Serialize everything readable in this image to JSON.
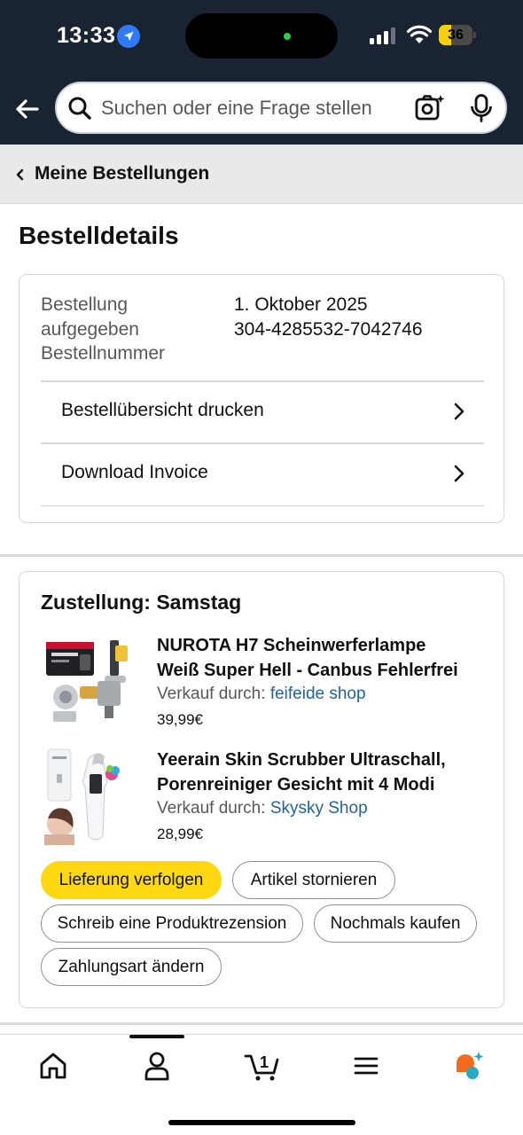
{
  "status_bar": {
    "time": "13:33",
    "battery": "36",
    "battery_level": 0.36
  },
  "header": {
    "search_placeholder": "Suchen oder eine Frage stellen"
  },
  "breadcrumb": {
    "label": "Meine Bestellungen"
  },
  "page": {
    "title": "Bestelldetails"
  },
  "order": {
    "label": "Bestellung aufgegeben Bestellnummer",
    "date": "1. Oktober 2025",
    "number": "304-4285532-7042746",
    "rows": [
      {
        "label": "Bestellübersicht drucken"
      },
      {
        "label": "Download Invoice"
      }
    ]
  },
  "delivery": {
    "title": "Zustellung: Samstag",
    "seller_prefix": "Verkauf durch:",
    "items": [
      {
        "title_line1": "NUROTA H7 Scheinwerferlampe",
        "title_line2": "Weiß Super Hell - Canbus Fehlerfrei",
        "seller": "feifeide shop",
        "price": "39,99€"
      },
      {
        "title_line1": "Yeerain Skin Scrubber Ultraschall,",
        "title_line2": "Porenreiniger Gesicht mit 4 Modi",
        "seller": "Skysky Shop",
        "price": "28,99€"
      }
    ],
    "buttons": {
      "track": "Lieferung verfolgen",
      "cancel": "Artikel stornieren",
      "review": "Schreib eine Produktrezension",
      "buy_again": "Nochmals kaufen",
      "change_payment": "Zahlungsart ändern"
    }
  },
  "tabbar": {
    "cart_count": "1",
    "active_tab": "account"
  },
  "colors": {
    "header_bg": "#1a2332",
    "primary_button": "#ffd814",
    "link": "#2162a1"
  }
}
